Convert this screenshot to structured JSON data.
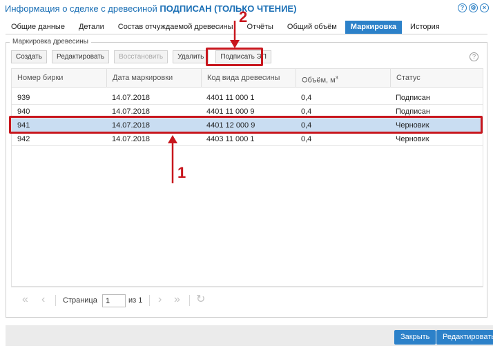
{
  "window": {
    "title_prefix": "Информация о сделке с древесиной ",
    "title_status": "ПОДПИСАН",
    "title_suffix": " (ТОЛЬКО ЧТЕНИЕ)",
    "icons": [
      "help-icon",
      "settings-icon",
      "close-icon"
    ],
    "icon_glyphs": {
      "help": "?",
      "settings": "⚙",
      "close": "×"
    }
  },
  "tabs": [
    {
      "label": "Общие данные"
    },
    {
      "label": "Детали"
    },
    {
      "label": "Состав отчуждаемой древесины"
    },
    {
      "label": "Отчёты"
    },
    {
      "label": "Общий объём"
    },
    {
      "label": "Маркировка",
      "active": true
    },
    {
      "label": "История"
    }
  ],
  "panel": {
    "legend": "Маркировка древесины",
    "help_glyph": "?"
  },
  "toolbar": {
    "create": "Создать",
    "edit": "Редактировать",
    "restore": "Восстановить",
    "delete": "Удалить",
    "sign": "Подписать ЭП"
  },
  "grid": {
    "columns": {
      "tag": "Номер бирки",
      "date": "Дата маркировки",
      "species": "Код вида древесины",
      "volume": "Объём, м",
      "volume_sup": "3",
      "status": "Статус"
    },
    "rows": [
      {
        "tag": "939",
        "date": "14.07.2018",
        "species": "4401 11 000 1",
        "volume": "0,4",
        "status": "Подписан"
      },
      {
        "tag": "940",
        "date": "14.07.2018",
        "species": "4401 11 000 9",
        "volume": "0,4",
        "status": "Подписан"
      },
      {
        "tag": "941",
        "date": "14.07.2018",
        "species": "4401 12 000 9",
        "volume": "0,4",
        "status": "Черновик",
        "selected": true
      },
      {
        "tag": "942",
        "date": "14.07.2018",
        "species": "4403 11 000 1",
        "volume": "0,4",
        "status": "Черновик"
      }
    ]
  },
  "pager": {
    "page_label": "Страница",
    "page_value": "1",
    "of_label": "из 1",
    "glyphs": {
      "first": "«",
      "prev": "‹",
      "next": "›",
      "last": "»",
      "refresh": "↻"
    }
  },
  "footer": {
    "close": "Закрыть",
    "edit": "Редактировать"
  },
  "annotations": {
    "step1": "1",
    "step2": "2",
    "color": "#c8161d"
  },
  "colors": {
    "accent": "#2c81c9",
    "selected_row": "#c9ddf2",
    "title": "#1a6fb5"
  }
}
